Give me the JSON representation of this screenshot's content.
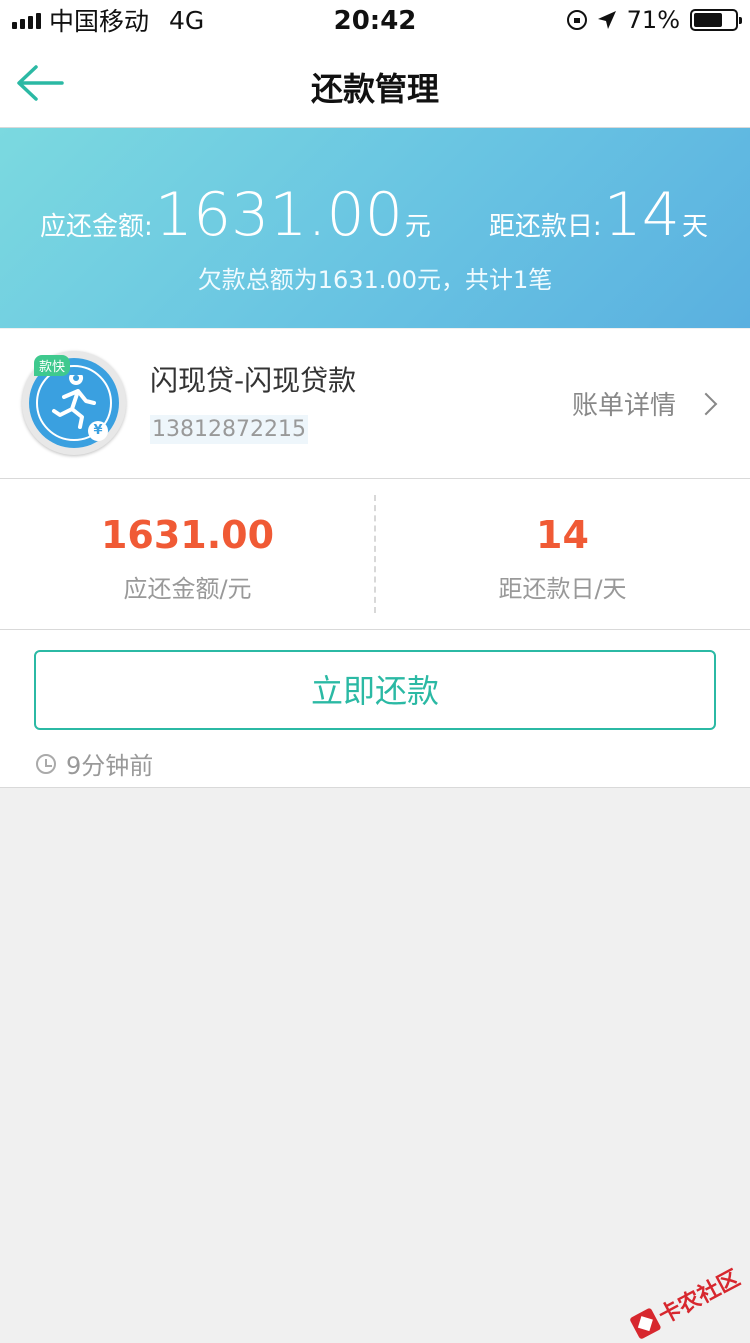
{
  "status_bar": {
    "carrier": "中国移动",
    "network": "4G",
    "time": "20:42",
    "battery": "71%",
    "battery_level": 0.71
  },
  "nav": {
    "title": "还款管理"
  },
  "summary": {
    "amount_label": "应还金额:",
    "amount_value": "1631.00",
    "amount_unit": "元",
    "days_label": "距还款日:",
    "days_value": "14",
    "days_unit": "天",
    "total_text": "欠款总额为1631.00元，共计1笔"
  },
  "loan": {
    "logo_tag": "款快",
    "logo_yen": "¥",
    "name": "闪现贷-闪现贷款",
    "phone": "13812872215",
    "detail_label": "账单详情"
  },
  "stats": {
    "amount_value": "1631.00",
    "amount_label": "应还金额/元",
    "days_value": "14",
    "days_label": "距还款日/天"
  },
  "action": {
    "pay_label": "立即还款",
    "updated_text": "9分钟前"
  },
  "watermark": {
    "text": "卡农社区"
  },
  "colors": {
    "accent": "#2bb9a4",
    "highlight": "#f05a35",
    "banner_start": "#7bd9e0",
    "banner_end": "#5ab0e0"
  }
}
